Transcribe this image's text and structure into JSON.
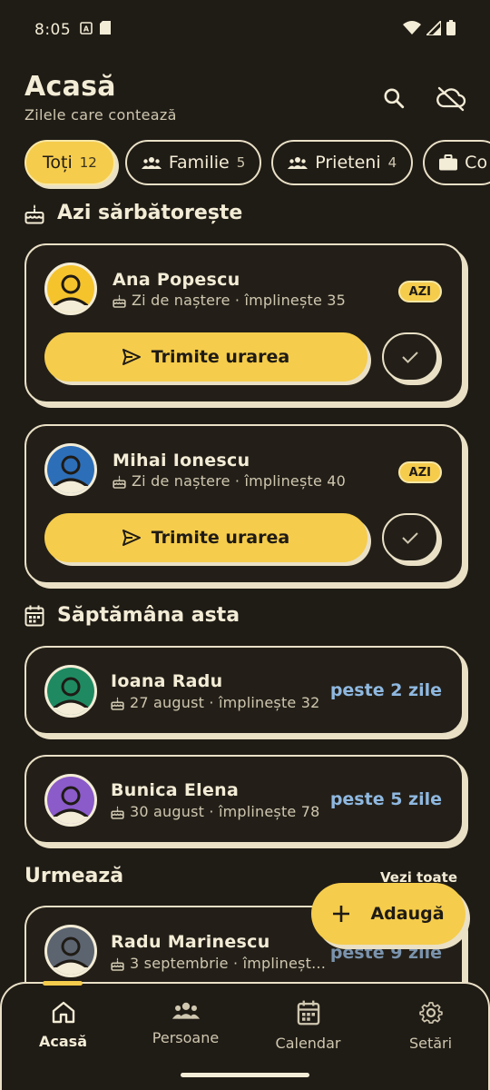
{
  "status": {
    "time": "8:05"
  },
  "header": {
    "title": "Acasă",
    "subtitle": "Zilele care contează"
  },
  "filters": [
    {
      "label": "Toți",
      "count": "12"
    },
    {
      "label": "Familie",
      "count": "5"
    },
    {
      "label": "Prieteni",
      "count": "4"
    },
    {
      "label": "Co",
      "count": ""
    }
  ],
  "today_section": {
    "title": "Azi sărbătorește",
    "items": [
      {
        "name": "Ana Popescu",
        "detail": "Zi de naștere · împlinește 35",
        "badge": "AZI",
        "action": "Trimite urarea",
        "avatar_color": "#f5c32c"
      },
      {
        "name": "Mihai Ionescu",
        "detail": "Zi de naștere · împlinește 40",
        "badge": "AZI",
        "action": "Trimite urarea",
        "avatar_color": "#2d6eb8"
      }
    ]
  },
  "week_section": {
    "title": "Săptămâna asta",
    "items": [
      {
        "name": "Ioana Radu",
        "detail": "27 august · împlinește 32",
        "countdown": "peste 2 zile",
        "avatar_color": "#1f8a62"
      },
      {
        "name": "Bunica Elena",
        "detail": "30 august · împlinește 78",
        "countdown": "peste 5 zile",
        "avatar_color": "#8a5bc9"
      }
    ]
  },
  "upcoming_section": {
    "title": "Urmează",
    "see_all": "Vezi toate",
    "items": [
      {
        "name": "Radu Marinescu",
        "detail": "3 septembrie · împlineșt…",
        "countdown": "peste 9 zile",
        "avatar_color": "#5c6470"
      }
    ]
  },
  "fab": {
    "label": "Adaugă"
  },
  "nav": [
    {
      "label": "Acasă",
      "icon": "home-icon"
    },
    {
      "label": "Persoane",
      "icon": "people-icon"
    },
    {
      "label": "Calendar",
      "icon": "calendar-icon"
    },
    {
      "label": "Setări",
      "icon": "settings-icon"
    }
  ],
  "colors": {
    "accent": "#f5cc4c",
    "background": "#1f1b15",
    "outline": "#e9e0c6",
    "countdown": "#8fb8e0"
  }
}
